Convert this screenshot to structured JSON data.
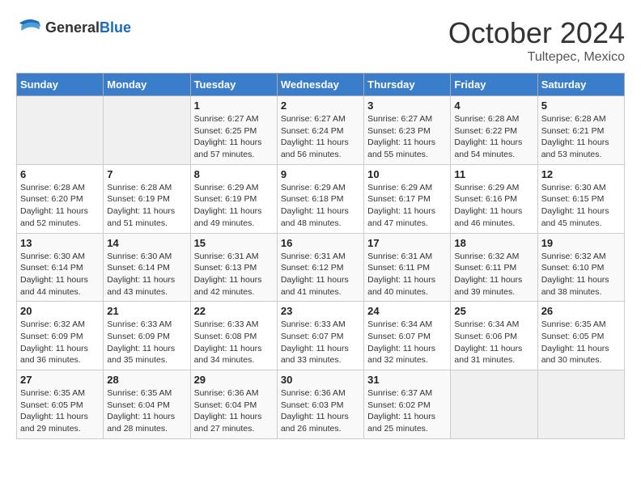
{
  "header": {
    "logo_general": "General",
    "logo_blue": "Blue",
    "month_title": "October 2024",
    "subtitle": "Tultepec, Mexico"
  },
  "days_of_week": [
    "Sunday",
    "Monday",
    "Tuesday",
    "Wednesday",
    "Thursday",
    "Friday",
    "Saturday"
  ],
  "weeks": [
    [
      {
        "day": "",
        "info": ""
      },
      {
        "day": "",
        "info": ""
      },
      {
        "day": "1",
        "info": "Sunrise: 6:27 AM\nSunset: 6:25 PM\nDaylight: 11 hours and 57 minutes."
      },
      {
        "day": "2",
        "info": "Sunrise: 6:27 AM\nSunset: 6:24 PM\nDaylight: 11 hours and 56 minutes."
      },
      {
        "day": "3",
        "info": "Sunrise: 6:27 AM\nSunset: 6:23 PM\nDaylight: 11 hours and 55 minutes."
      },
      {
        "day": "4",
        "info": "Sunrise: 6:28 AM\nSunset: 6:22 PM\nDaylight: 11 hours and 54 minutes."
      },
      {
        "day": "5",
        "info": "Sunrise: 6:28 AM\nSunset: 6:21 PM\nDaylight: 11 hours and 53 minutes."
      }
    ],
    [
      {
        "day": "6",
        "info": "Sunrise: 6:28 AM\nSunset: 6:20 PM\nDaylight: 11 hours and 52 minutes."
      },
      {
        "day": "7",
        "info": "Sunrise: 6:28 AM\nSunset: 6:19 PM\nDaylight: 11 hours and 51 minutes."
      },
      {
        "day": "8",
        "info": "Sunrise: 6:29 AM\nSunset: 6:19 PM\nDaylight: 11 hours and 49 minutes."
      },
      {
        "day": "9",
        "info": "Sunrise: 6:29 AM\nSunset: 6:18 PM\nDaylight: 11 hours and 48 minutes."
      },
      {
        "day": "10",
        "info": "Sunrise: 6:29 AM\nSunset: 6:17 PM\nDaylight: 11 hours and 47 minutes."
      },
      {
        "day": "11",
        "info": "Sunrise: 6:29 AM\nSunset: 6:16 PM\nDaylight: 11 hours and 46 minutes."
      },
      {
        "day": "12",
        "info": "Sunrise: 6:30 AM\nSunset: 6:15 PM\nDaylight: 11 hours and 45 minutes."
      }
    ],
    [
      {
        "day": "13",
        "info": "Sunrise: 6:30 AM\nSunset: 6:14 PM\nDaylight: 11 hours and 44 minutes."
      },
      {
        "day": "14",
        "info": "Sunrise: 6:30 AM\nSunset: 6:14 PM\nDaylight: 11 hours and 43 minutes."
      },
      {
        "day": "15",
        "info": "Sunrise: 6:31 AM\nSunset: 6:13 PM\nDaylight: 11 hours and 42 minutes."
      },
      {
        "day": "16",
        "info": "Sunrise: 6:31 AM\nSunset: 6:12 PM\nDaylight: 11 hours and 41 minutes."
      },
      {
        "day": "17",
        "info": "Sunrise: 6:31 AM\nSunset: 6:11 PM\nDaylight: 11 hours and 40 minutes."
      },
      {
        "day": "18",
        "info": "Sunrise: 6:32 AM\nSunset: 6:11 PM\nDaylight: 11 hours and 39 minutes."
      },
      {
        "day": "19",
        "info": "Sunrise: 6:32 AM\nSunset: 6:10 PM\nDaylight: 11 hours and 38 minutes."
      }
    ],
    [
      {
        "day": "20",
        "info": "Sunrise: 6:32 AM\nSunset: 6:09 PM\nDaylight: 11 hours and 36 minutes."
      },
      {
        "day": "21",
        "info": "Sunrise: 6:33 AM\nSunset: 6:09 PM\nDaylight: 11 hours and 35 minutes."
      },
      {
        "day": "22",
        "info": "Sunrise: 6:33 AM\nSunset: 6:08 PM\nDaylight: 11 hours and 34 minutes."
      },
      {
        "day": "23",
        "info": "Sunrise: 6:33 AM\nSunset: 6:07 PM\nDaylight: 11 hours and 33 minutes."
      },
      {
        "day": "24",
        "info": "Sunrise: 6:34 AM\nSunset: 6:07 PM\nDaylight: 11 hours and 32 minutes."
      },
      {
        "day": "25",
        "info": "Sunrise: 6:34 AM\nSunset: 6:06 PM\nDaylight: 11 hours and 31 minutes."
      },
      {
        "day": "26",
        "info": "Sunrise: 6:35 AM\nSunset: 6:05 PM\nDaylight: 11 hours and 30 minutes."
      }
    ],
    [
      {
        "day": "27",
        "info": "Sunrise: 6:35 AM\nSunset: 6:05 PM\nDaylight: 11 hours and 29 minutes."
      },
      {
        "day": "28",
        "info": "Sunrise: 6:35 AM\nSunset: 6:04 PM\nDaylight: 11 hours and 28 minutes."
      },
      {
        "day": "29",
        "info": "Sunrise: 6:36 AM\nSunset: 6:04 PM\nDaylight: 11 hours and 27 minutes."
      },
      {
        "day": "30",
        "info": "Sunrise: 6:36 AM\nSunset: 6:03 PM\nDaylight: 11 hours and 26 minutes."
      },
      {
        "day": "31",
        "info": "Sunrise: 6:37 AM\nSunset: 6:02 PM\nDaylight: 11 hours and 25 minutes."
      },
      {
        "day": "",
        "info": ""
      },
      {
        "day": "",
        "info": ""
      }
    ]
  ]
}
